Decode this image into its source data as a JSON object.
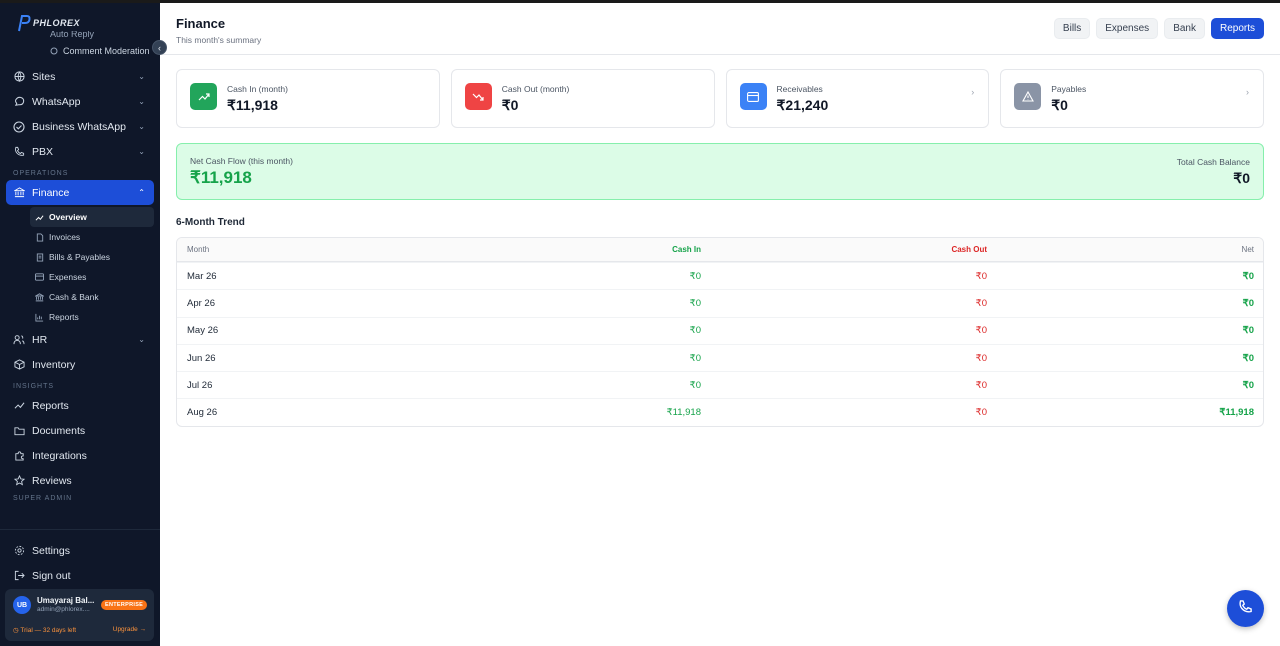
{
  "brand": {
    "name": "PHLOREX"
  },
  "sidebar": {
    "partial_item": "Auto Reply",
    "comment_moderation": "Comment Moderation",
    "items_top": [
      {
        "label": "Sites",
        "icon": "globe-icon"
      },
      {
        "label": "WhatsApp",
        "icon": "chat-bubble-icon"
      },
      {
        "label": "Business WhatsApp",
        "icon": "check-circle-icon"
      },
      {
        "label": "PBX",
        "icon": "phone-icon"
      }
    ],
    "section_operations": "OPERATIONS",
    "finance_label": "Finance",
    "finance_sub": [
      {
        "label": "Overview",
        "icon": "trend-icon"
      },
      {
        "label": "Invoices",
        "icon": "file-icon"
      },
      {
        "label": "Bills & Payables",
        "icon": "receipt-icon"
      },
      {
        "label": "Expenses",
        "icon": "card-icon"
      },
      {
        "label": "Cash & Bank",
        "icon": "bank-icon"
      },
      {
        "label": "Reports",
        "icon": "bar-chart-icon"
      }
    ],
    "hr_label": "HR",
    "inventory_label": "Inventory",
    "section_insights": "INSIGHTS",
    "insights_items": [
      {
        "label": "Reports",
        "icon": "trend-icon"
      },
      {
        "label": "Documents",
        "icon": "folder-icon"
      },
      {
        "label": "Integrations",
        "icon": "puzzle-icon"
      },
      {
        "label": "Reviews",
        "icon": "star-icon"
      }
    ],
    "section_super_admin": "SUPER ADMIN",
    "settings_label": "Settings",
    "signout_label": "Sign out",
    "user": {
      "initials": "UB",
      "name": "Umayaraj Bal...",
      "email": "admin@phlorex....",
      "plan": "ENTERPRISE",
      "trial": "◷ Trial — 32 days left",
      "upgrade": "Upgrade →"
    }
  },
  "header": {
    "title": "Finance",
    "subtitle": "This month's summary",
    "buttons": [
      "Bills",
      "Expenses",
      "Bank",
      "Reports"
    ]
  },
  "cards": [
    {
      "label": "Cash In (month)",
      "value": "₹11,918",
      "color": "#22a55b",
      "icon": "trend-up-icon"
    },
    {
      "label": "Cash Out (month)",
      "value": "₹0",
      "color": "#ef4444",
      "icon": "trend-down-icon"
    },
    {
      "label": "Receivables",
      "value": "₹21,240",
      "color": "#3b82f6",
      "icon": "card-icon"
    },
    {
      "label": "Payables",
      "value": "₹0",
      "color": "#8a94a6",
      "icon": "warning-icon"
    }
  ],
  "netflow": {
    "label": "Net Cash Flow (this month)",
    "value": "₹11,918",
    "balance_label": "Total Cash Balance",
    "balance_value": "₹0"
  },
  "trend": {
    "title": "6-Month Trend",
    "columns": [
      "Month",
      "Cash In",
      "Cash Out",
      "Net"
    ],
    "rows": [
      {
        "month": "Mar 26",
        "in": "₹0",
        "out": "₹0",
        "net": "₹0"
      },
      {
        "month": "Apr 26",
        "in": "₹0",
        "out": "₹0",
        "net": "₹0"
      },
      {
        "month": "May 26",
        "in": "₹0",
        "out": "₹0",
        "net": "₹0"
      },
      {
        "month": "Jun 26",
        "in": "₹0",
        "out": "₹0",
        "net": "₹0"
      },
      {
        "month": "Jul 26",
        "in": "₹0",
        "out": "₹0",
        "net": "₹0"
      },
      {
        "month": "Aug 26",
        "in": "₹11,918",
        "out": "₹0",
        "net": "₹11,918"
      }
    ]
  }
}
